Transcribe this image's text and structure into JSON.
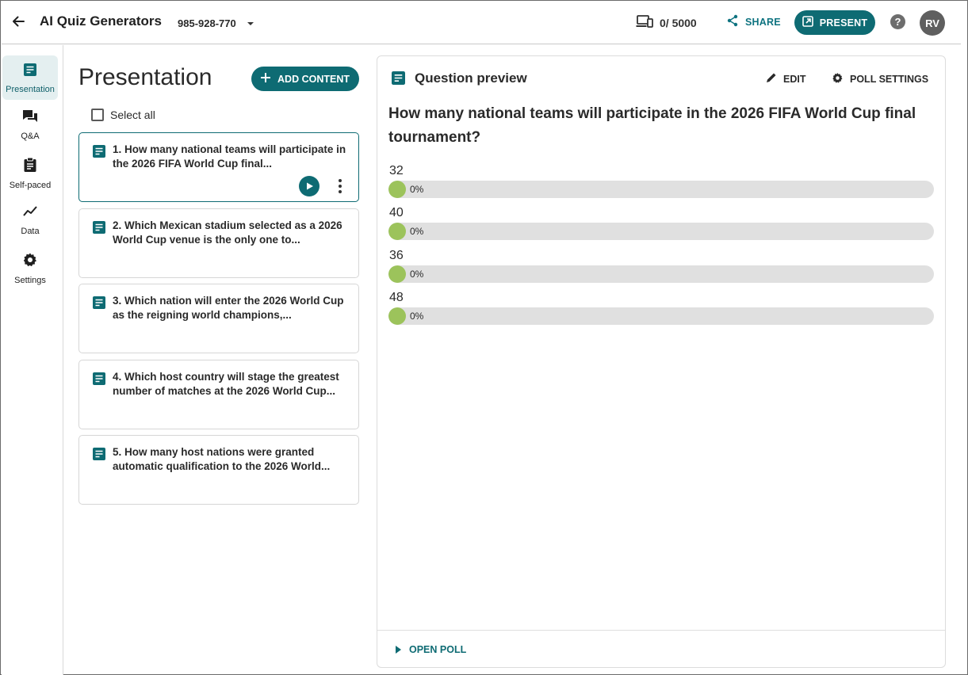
{
  "header": {
    "app_title": "AI Quiz Generators",
    "event_code": "985-928-770",
    "participants": "0/ 5000",
    "share_label": "SHARE",
    "present_label": "PRESENT",
    "help_label": "?",
    "avatar_initials": "RV"
  },
  "sidebar": {
    "items": [
      {
        "label": "Presentation",
        "icon": "slides-icon",
        "active": true
      },
      {
        "label": "Q&A",
        "icon": "chat-icon",
        "active": false
      },
      {
        "label": "Self-paced",
        "icon": "clipboard-icon",
        "active": false
      },
      {
        "label": "Data",
        "icon": "trend-icon",
        "active": false
      },
      {
        "label": "Settings",
        "icon": "gear-icon",
        "active": false
      }
    ]
  },
  "content_list": {
    "title": "Presentation",
    "add_content_label": "ADD CONTENT",
    "select_all_label": "Select all",
    "questions": [
      {
        "text": "1. How many national teams will participate in the 2026 FIFA World Cup final..."
      },
      {
        "text": "2. Which Mexican stadium selected as a 2026 World Cup venue is the only one to..."
      },
      {
        "text": "3. Which nation will enter the 2026 World Cup as the reigning world champions,..."
      },
      {
        "text": "4. Which host country will stage the greatest number of matches at the 2026 World Cup..."
      },
      {
        "text": "5. How many host nations were granted automatic qualification to the 2026 World..."
      }
    ]
  },
  "preview": {
    "title": "Question preview",
    "edit_label": "EDIT",
    "poll_settings_label": "POLL SETTINGS",
    "question": "How many national teams will participate in the 2026 FIFA World Cup final tournament?",
    "options": [
      {
        "label": "32",
        "percent_text": "0%",
        "percent": 0
      },
      {
        "label": "40",
        "percent_text": "0%",
        "percent": 0
      },
      {
        "label": "36",
        "percent_text": "0%",
        "percent": 0
      },
      {
        "label": "48",
        "percent_text": "0%",
        "percent": 0
      }
    ],
    "open_poll_label": "OPEN POLL"
  },
  "colors": {
    "accent": "#0e6b73",
    "bar_fill": "#9cc35b",
    "bar_track": "#e0e0e0"
  }
}
